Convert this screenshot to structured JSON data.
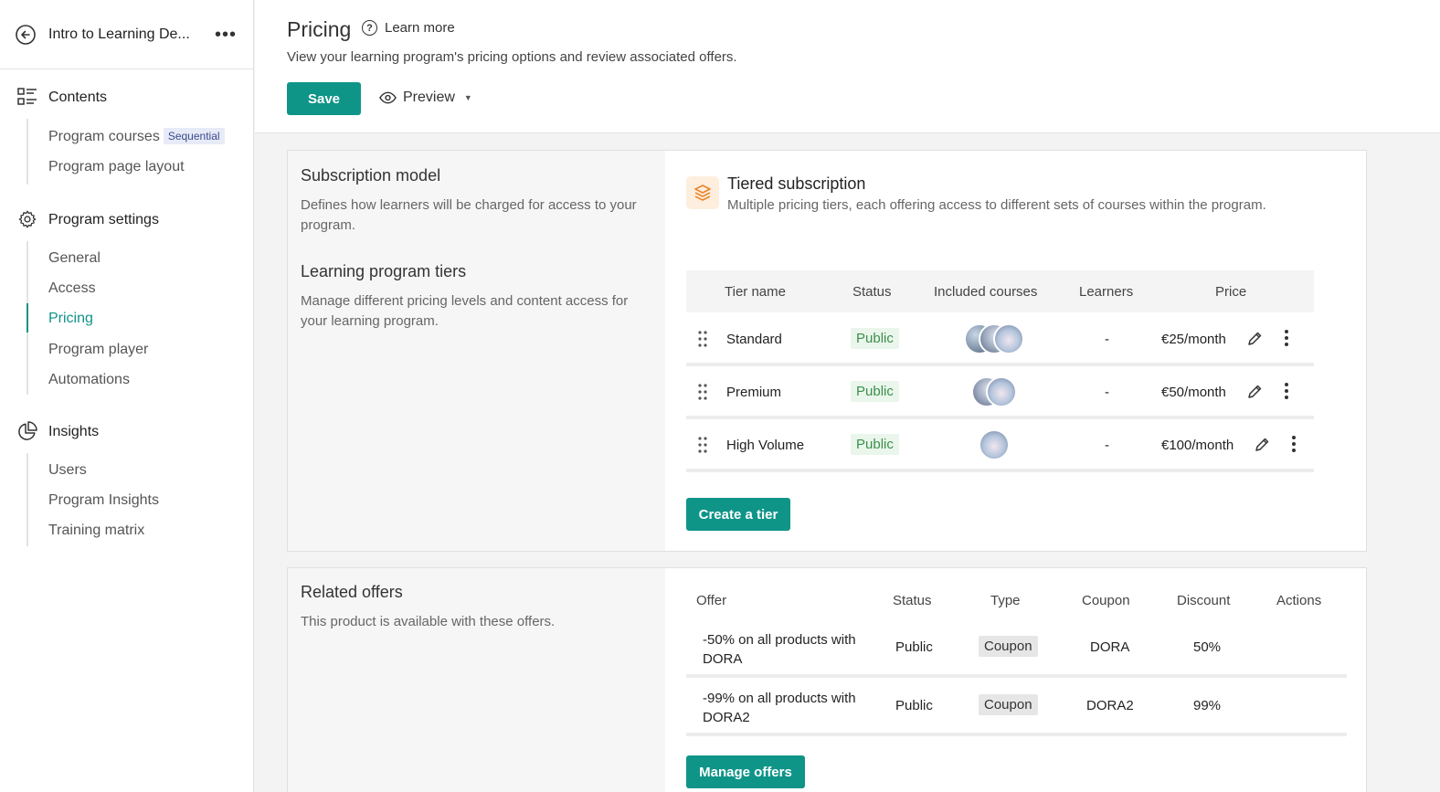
{
  "sidebar": {
    "program_title": "Intro to Learning De...",
    "sections": [
      {
        "label": "Contents",
        "icon": "list-icon"
      },
      {
        "label": "Program settings",
        "icon": "gear-icon"
      },
      {
        "label": "Insights",
        "icon": "pie-chart-icon"
      }
    ],
    "contents_items": [
      "Program courses",
      "Program page layout"
    ],
    "contents_badge": "Sequential",
    "settings_items": [
      "General",
      "Access",
      "Pricing",
      "Program player",
      "Automations"
    ],
    "insights_items": [
      "Users",
      "Program Insights",
      "Training matrix"
    ],
    "active_item": "Pricing"
  },
  "header": {
    "title": "Pricing",
    "learn_more": "Learn more",
    "subtitle": "View your learning program's pricing options and review associated offers.",
    "save_label": "Save",
    "preview_label": "Preview"
  },
  "subscription": {
    "model_title": "Subscription model",
    "model_desc": "Defines how learners will be charged for access to your program.",
    "tiers_title": "Learning program tiers",
    "tiers_desc": "Manage different pricing levels and content access for your learning program.",
    "type_title": "Tiered subscription",
    "type_desc": "Multiple pricing tiers, each offering access to different sets of courses within the program.",
    "columns": [
      "Tier name",
      "Status",
      "Included courses",
      "Learners",
      "Price"
    ],
    "tiers": [
      {
        "name": "Standard",
        "status": "Public",
        "courses": 3,
        "learners": "-",
        "price": "€25/month"
      },
      {
        "name": "Premium",
        "status": "Public",
        "courses": 2,
        "learners": "-",
        "price": "€50/month"
      },
      {
        "name": "High Volume",
        "status": "Public",
        "courses": 1,
        "learners": "-",
        "price": "€100/month"
      }
    ],
    "create_label": "Create a tier"
  },
  "offers": {
    "title": "Related offers",
    "desc": "This product is available with these offers.",
    "columns": [
      "Offer",
      "Status",
      "Type",
      "Coupon",
      "Discount",
      "Actions"
    ],
    "rows": [
      {
        "offer_line1": "-50% on all products with",
        "offer_line2": "DORA",
        "status": "Public",
        "type": "Coupon",
        "coupon": "DORA",
        "discount": "50%"
      },
      {
        "offer_line1": "-99% on all products with",
        "offer_line2": "DORA2",
        "status": "Public",
        "type": "Coupon",
        "coupon": "DORA2",
        "discount": "99%"
      }
    ],
    "manage_label": "Manage offers"
  },
  "colors": {
    "accent": "#0f9488",
    "public_bg": "#eaf6ec",
    "public_text": "#3c8f4b",
    "tier_icon": "#e8862a"
  }
}
